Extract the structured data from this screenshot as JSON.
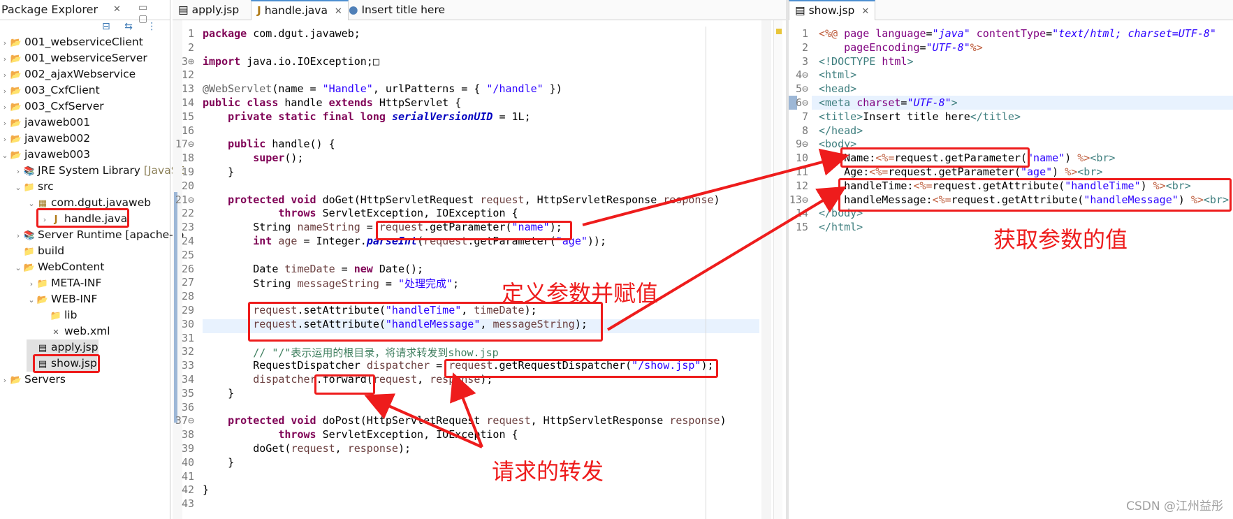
{
  "explorer": {
    "title": "Package Explorer",
    "close": "✕",
    "minmax": "▭ ▢",
    "toolbar": "⊟ ⇆ ⋮",
    "items": [
      {
        "label": "001_webserviceClient",
        "twisty": "›",
        "icon": "📂"
      },
      {
        "label": "001_webserviceServer",
        "twisty": "›",
        "icon": "📂"
      },
      {
        "label": "002_ajaxWebservice",
        "twisty": "›",
        "icon": "📂"
      },
      {
        "label": "003_CxfClient",
        "twisty": "›",
        "icon": "📂"
      },
      {
        "label": "003_CxfServer",
        "twisty": "›",
        "icon": "📂"
      },
      {
        "label": "javaweb001",
        "twisty": "›",
        "icon": "📂"
      },
      {
        "label": "javaweb002",
        "twisty": "›",
        "icon": "📂"
      },
      {
        "label": "javaweb003",
        "twisty": "⌄",
        "icon": "📂"
      },
      {
        "label": "JRE System Library",
        "suffix": "[JavaSE",
        "twisty": "›",
        "icon": "📚"
      },
      {
        "label": "src",
        "twisty": "⌄",
        "icon": "📁"
      },
      {
        "label": "com.dgut.javaweb",
        "twisty": "⌄",
        "icon": "▦"
      },
      {
        "label": "handle.java",
        "twisty": "›",
        "icon": "J"
      },
      {
        "label": "Server Runtime [apache-to",
        "twisty": "›",
        "icon": "📚"
      },
      {
        "label": "build",
        "twisty": "",
        "icon": "📁"
      },
      {
        "label": "WebContent",
        "twisty": "⌄",
        "icon": "📂"
      },
      {
        "label": "META-INF",
        "twisty": "›",
        "icon": "📁"
      },
      {
        "label": "WEB-INF",
        "twisty": "⌄",
        "icon": "📂"
      },
      {
        "label": "lib",
        "twisty": "",
        "icon": "📁"
      },
      {
        "label": "web.xml",
        "twisty": "",
        "icon": "✕"
      },
      {
        "label": "apply.jsp",
        "twisty": "",
        "icon": "▤"
      },
      {
        "label": "show.jsp",
        "twisty": "",
        "icon": "▤"
      },
      {
        "label": "Servers",
        "twisty": "›",
        "icon": "📂"
      }
    ]
  },
  "editor_tabs": [
    {
      "label": "apply.jsp",
      "icon": "▤"
    },
    {
      "label": "handle.java",
      "icon": "J",
      "close": "✕"
    },
    {
      "label": "Insert title here",
      "icon": "●"
    }
  ],
  "show_tab": {
    "label": "show.jsp",
    "icon": "▤",
    "close": "✕"
  },
  "java_lines": [
    {
      "n": "1",
      "parts": [
        [
          "kw",
          "package "
        ],
        [
          "",
          "com.dgut.javaweb;"
        ]
      ]
    },
    {
      "n": "2",
      "parts": []
    },
    {
      "n": "3⊕",
      "parts": [
        [
          "kw",
          "import "
        ],
        [
          "",
          "java.io.IOException;□"
        ]
      ]
    },
    {
      "n": "12",
      "parts": []
    },
    {
      "n": "13",
      "parts": [
        [
          "ann",
          "@WebServlet"
        ],
        [
          "",
          "(name = "
        ],
        [
          "str",
          "\"Handle\""
        ],
        [
          "",
          ", urlPatterns = { "
        ],
        [
          "str",
          "\"/handle\""
        ],
        [
          "",
          " })"
        ]
      ]
    },
    {
      "n": "14",
      "parts": [
        [
          "kw",
          "public class "
        ],
        [
          "",
          "handle "
        ],
        [
          "kw",
          "extends "
        ],
        [
          "",
          "HttpServlet {"
        ]
      ]
    },
    {
      "n": "15",
      "parts": [
        [
          "",
          "    "
        ],
        [
          "kw",
          "private static final long "
        ],
        [
          "fld",
          "serialVersionUID"
        ],
        [
          "",
          " = 1L;"
        ]
      ]
    },
    {
      "n": "16",
      "parts": []
    },
    {
      "n": "17⊖",
      "parts": [
        [
          "",
          "    "
        ],
        [
          "kw",
          "public "
        ],
        [
          "",
          "handle() {"
        ]
      ]
    },
    {
      "n": "18",
      "parts": [
        [
          "",
          "        "
        ],
        [
          "kw",
          "super"
        ],
        [
          "",
          "();"
        ]
      ]
    },
    {
      "n": "19",
      "parts": [
        [
          "",
          "    }"
        ]
      ]
    },
    {
      "n": "20",
      "parts": []
    },
    {
      "n": "21⊖",
      "parts": [
        [
          "",
          "    "
        ],
        [
          "kw",
          "protected void "
        ],
        [
          "",
          "doGet(HttpServletRequest "
        ],
        [
          "prm",
          "request"
        ],
        [
          "",
          ", HttpServletResponse "
        ],
        [
          "prm",
          "response"
        ],
        [
          "",
          ")"
        ]
      ]
    },
    {
      "n": "22",
      "parts": [
        [
          "",
          "            "
        ],
        [
          "kw",
          "throws "
        ],
        [
          "",
          "ServletException, IOException {"
        ]
      ]
    },
    {
      "n": "23",
      "parts": [
        [
          "",
          "        String "
        ],
        [
          "lv",
          "nameString"
        ],
        [
          "",
          " = "
        ],
        [
          "prm",
          "request"
        ],
        [
          "",
          ".getParameter("
        ],
        [
          "str",
          "\"name\""
        ],
        [
          "",
          ");"
        ]
      ]
    },
    {
      "n": "24",
      "parts": [
        [
          "",
          "        "
        ],
        [
          "kw",
          "int "
        ],
        [
          "lv",
          "age"
        ],
        [
          "",
          " = Integer."
        ],
        [
          "fld",
          "parseInt"
        ],
        [
          "",
          "("
        ],
        [
          "prm",
          "request"
        ],
        [
          "",
          ".getParameter("
        ],
        [
          "str",
          "\"age\""
        ],
        [
          "",
          "));"
        ]
      ]
    },
    {
      "n": "25",
      "parts": []
    },
    {
      "n": "26",
      "parts": [
        [
          "",
          "        Date "
        ],
        [
          "lv",
          "timeDate"
        ],
        [
          "",
          " = "
        ],
        [
          "kw",
          "new "
        ],
        [
          "",
          "Date();"
        ]
      ]
    },
    {
      "n": "27",
      "parts": [
        [
          "",
          "        String "
        ],
        [
          "lv",
          "messageString"
        ],
        [
          "",
          " = "
        ],
        [
          "str",
          "\"处理完成\""
        ],
        [
          "",
          ";"
        ]
      ]
    },
    {
      "n": "28",
      "parts": []
    },
    {
      "n": "29",
      "parts": [
        [
          "",
          "        "
        ],
        [
          "prm",
          "request"
        ],
        [
          "",
          ".setAttribute("
        ],
        [
          "str",
          "\"handleTime\""
        ],
        [
          "",
          ", "
        ],
        [
          "lv",
          "timeDate"
        ],
        [
          "",
          ");"
        ]
      ]
    },
    {
      "n": "30",
      "parts": [
        [
          "",
          "        "
        ],
        [
          "prm",
          "request"
        ],
        [
          "",
          ".setAttribute("
        ],
        [
          "str",
          "\"handleMessage\""
        ],
        [
          "",
          ", "
        ],
        [
          "lv",
          "messageString"
        ],
        [
          "",
          ");"
        ]
      ]
    },
    {
      "n": "31",
      "parts": []
    },
    {
      "n": "32",
      "parts": [
        [
          "",
          "        "
        ],
        [
          "cmt",
          "// \"/\"表示运用的根目录，将请求转发到show.jsp"
        ]
      ]
    },
    {
      "n": "33",
      "parts": [
        [
          "",
          "        RequestDispatcher "
        ],
        [
          "lv",
          "dispatcher"
        ],
        [
          "",
          " = "
        ],
        [
          "prm",
          "request"
        ],
        [
          "",
          ".getRequestDispatcher("
        ],
        [
          "str",
          "\"/show.jsp\""
        ],
        [
          "",
          ");"
        ]
      ]
    },
    {
      "n": "34",
      "parts": [
        [
          "",
          "        "
        ],
        [
          "lv",
          "dispatcher"
        ],
        [
          "",
          ".forward("
        ],
        [
          "prm",
          "request"
        ],
        [
          "",
          ", "
        ],
        [
          "prm",
          "response"
        ],
        [
          "",
          ");"
        ]
      ]
    },
    {
      "n": "35",
      "parts": [
        [
          "",
          "    }"
        ]
      ]
    },
    {
      "n": "36",
      "parts": []
    },
    {
      "n": "37⊖",
      "parts": [
        [
          "",
          "    "
        ],
        [
          "kw",
          "protected void "
        ],
        [
          "",
          "doPost(HttpServletRequest "
        ],
        [
          "prm",
          "request"
        ],
        [
          "",
          ", HttpServletResponse "
        ],
        [
          "prm",
          "response"
        ],
        [
          "",
          ")"
        ]
      ]
    },
    {
      "n": "38",
      "parts": [
        [
          "",
          "            "
        ],
        [
          "kw",
          "throws "
        ],
        [
          "",
          "ServletException, IOException {"
        ]
      ]
    },
    {
      "n": "39",
      "parts": [
        [
          "",
          "        doGet("
        ],
        [
          "prm",
          "request"
        ],
        [
          "",
          ", "
        ],
        [
          "prm",
          "response"
        ],
        [
          "",
          ");"
        ]
      ]
    },
    {
      "n": "40",
      "parts": [
        [
          "",
          "    }"
        ]
      ]
    },
    {
      "n": "41",
      "parts": []
    },
    {
      "n": "42",
      "parts": [
        [
          "",
          "}"
        ]
      ]
    },
    {
      "n": "43",
      "parts": []
    }
  ],
  "jsp_lines": [
    {
      "n": "1",
      "parts": [
        [
          "jsp",
          "<%@ "
        ],
        [
          "attrn",
          "page "
        ],
        [
          "attrn",
          "language"
        ],
        [
          "",
          "="
        ],
        [
          "attrv",
          "\"java\""
        ],
        [
          "",
          " "
        ],
        [
          "attrn",
          "contentType"
        ],
        [
          "",
          "="
        ],
        [
          "attrv",
          "\"text/html; charset=UTF-8\""
        ]
      ]
    },
    {
      "n": "2",
      "parts": [
        [
          "",
          "    "
        ],
        [
          "attrn",
          "pageEncoding"
        ],
        [
          "",
          "="
        ],
        [
          "attrv",
          "\"UTF-8\""
        ],
        [
          "jsp",
          "%>"
        ]
      ]
    },
    {
      "n": "3",
      "parts": [
        [
          "tag",
          "<!DOCTYPE "
        ],
        [
          "attrn",
          "html"
        ],
        [
          "tag",
          ">"
        ]
      ]
    },
    {
      "n": "4⊖",
      "parts": [
        [
          "tag",
          "<html>"
        ]
      ]
    },
    {
      "n": "5⊖",
      "parts": [
        [
          "tag",
          "<head>"
        ]
      ]
    },
    {
      "n": "6⊖",
      "parts": [
        [
          "tag",
          "<meta "
        ],
        [
          "attrn",
          "charset"
        ],
        [
          "",
          "="
        ],
        [
          "attrv",
          "\"UTF-8\""
        ],
        [
          "tag",
          ">"
        ]
      ]
    },
    {
      "n": "7",
      "parts": [
        [
          "tag",
          "<title>"
        ],
        [
          "",
          "Insert title here"
        ],
        [
          "tag",
          "</title>"
        ]
      ]
    },
    {
      "n": "8",
      "parts": [
        [
          "tag",
          "</head>"
        ]
      ]
    },
    {
      "n": "9⊖",
      "parts": [
        [
          "tag",
          "<body>"
        ]
      ]
    },
    {
      "n": "10",
      "parts": [
        [
          "",
          "    Name:"
        ],
        [
          "jsp",
          "<%="
        ],
        [
          "",
          "request.getParameter("
        ],
        [
          "str",
          "\"name\""
        ],
        [
          "",
          ") "
        ],
        [
          "jsp",
          "%>"
        ],
        [
          "tag",
          "<br>"
        ]
      ]
    },
    {
      "n": "11",
      "parts": [
        [
          "",
          "    Age:"
        ],
        [
          "jsp",
          "<%="
        ],
        [
          "",
          "request.getParameter("
        ],
        [
          "str",
          "\"age\""
        ],
        [
          "",
          ") "
        ],
        [
          "jsp",
          "%>"
        ],
        [
          "tag",
          "<br>"
        ]
      ]
    },
    {
      "n": "12",
      "parts": [
        [
          "",
          "    handleTime:"
        ],
        [
          "jsp",
          "<%="
        ],
        [
          "",
          "request.getAttribute("
        ],
        [
          "str",
          "\"handleTime\""
        ],
        [
          "",
          ") "
        ],
        [
          "jsp",
          "%>"
        ],
        [
          "tag",
          "<br>"
        ]
      ]
    },
    {
      "n": "13⊖",
      "parts": [
        [
          "",
          "    handleMessage:"
        ],
        [
          "jsp",
          "<%="
        ],
        [
          "",
          "request.getAttribute("
        ],
        [
          "str",
          "\"handleMessage\""
        ],
        [
          "",
          ") "
        ],
        [
          "jsp",
          "%>"
        ],
        [
          "tag",
          "<br>"
        ]
      ]
    },
    {
      "n": "14",
      "parts": [
        [
          "tag",
          "</body>"
        ]
      ]
    },
    {
      "n": "15",
      "parts": [
        [
          "tag",
          "</html>"
        ]
      ]
    }
  ],
  "annotations": {
    "define": "定义参数并赋值",
    "forward": "请求的转发",
    "get_values": "获取参数的值"
  },
  "watermark": "CSDN @江州益彤",
  "colors": {
    "highlight_red": "#ee1c1c",
    "keyword": "#7f0055",
    "string": "#2a00ff",
    "tag": "#3f7f7f"
  }
}
